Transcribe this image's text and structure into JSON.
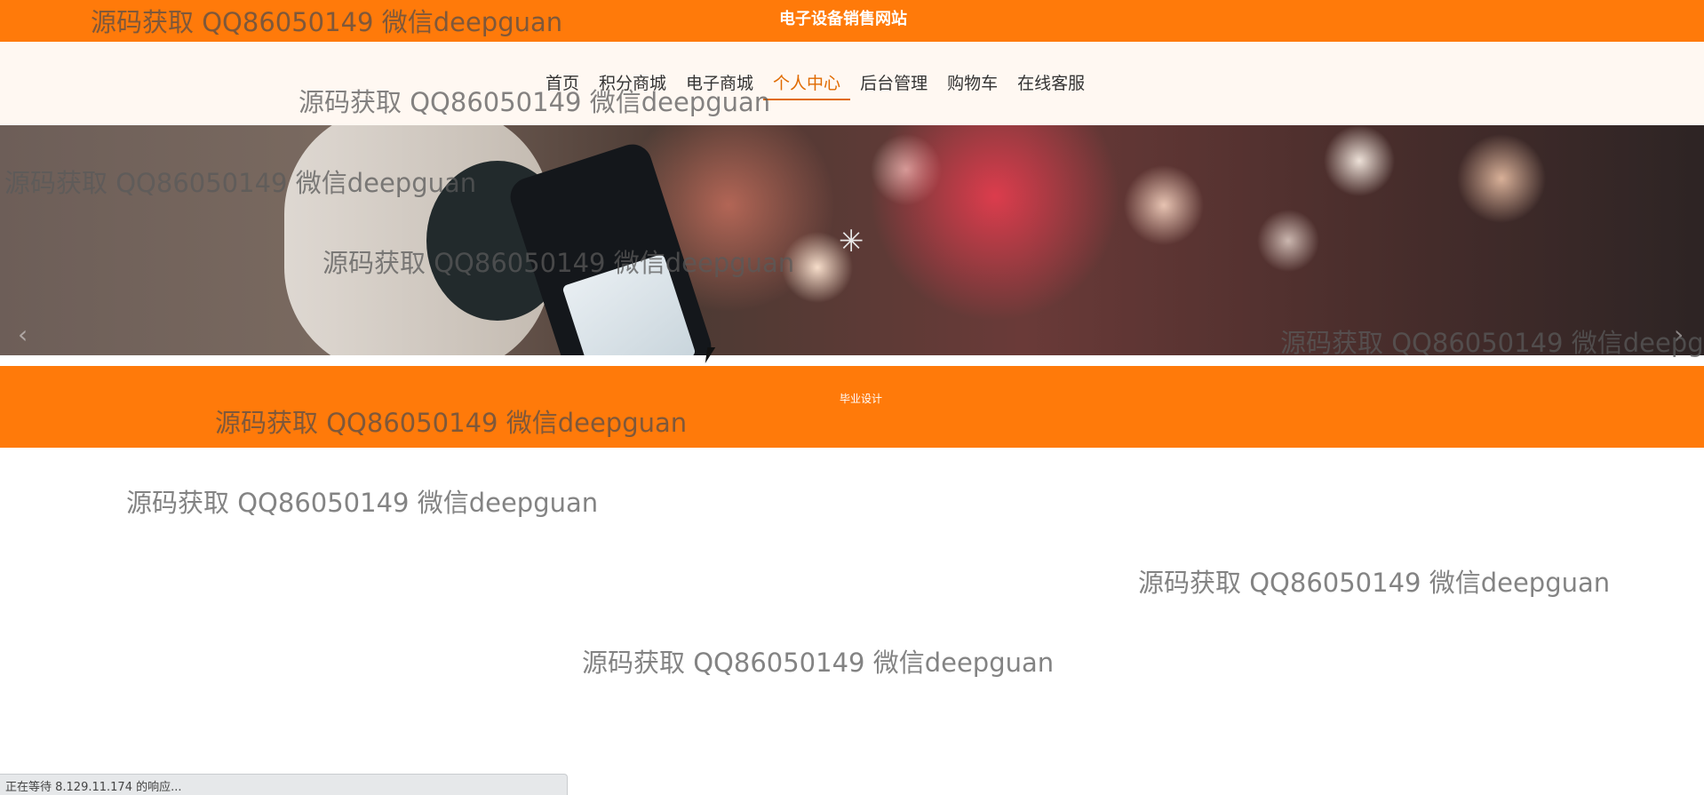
{
  "header": {
    "site_title": "电子设备销售网站"
  },
  "nav": {
    "items": [
      {
        "label": "首页",
        "active": false
      },
      {
        "label": "积分商城",
        "active": false
      },
      {
        "label": "电子商城",
        "active": false
      },
      {
        "label": "个人中心",
        "active": true
      },
      {
        "label": "后台管理",
        "active": false
      },
      {
        "label": "购物车",
        "active": false
      },
      {
        "label": "在线客服",
        "active": false
      }
    ]
  },
  "carousel": {
    "loading_icon": "spinner-icon",
    "prev_icon": "chevron-left-icon",
    "next_icon": "chevron-right-icon",
    "prev_glyph": "‹",
    "next_glyph": "›"
  },
  "footer": {
    "text": "毕业设计"
  },
  "watermark": {
    "text": "源码获取 QQ86050149 微信deepguan"
  },
  "status_bar": {
    "text": "正在等待 8.129.11.174 的响应..."
  },
  "colors": {
    "accent": "#ff7a0a",
    "nav_active": "#e06a00",
    "nav_background": "#fff8f2"
  }
}
